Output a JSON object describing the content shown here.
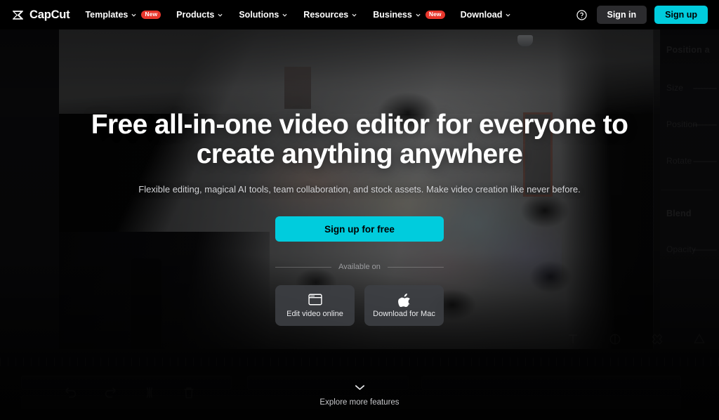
{
  "navbar": {
    "brand": {
      "logo_icon": "capcut-logo-icon",
      "name": "CapCut"
    },
    "links": [
      {
        "label": "Templates",
        "caret": "chevron-down-icon",
        "badge": "New"
      },
      {
        "label": "Products",
        "caret": "chevron-down-icon",
        "badge": ""
      },
      {
        "label": "Solutions",
        "caret": "chevron-down-icon",
        "badge": ""
      },
      {
        "label": "Resources",
        "caret": "chevron-down-icon",
        "badge": ""
      },
      {
        "label": "Business",
        "caret": "chevron-down-icon",
        "badge": "New"
      },
      {
        "label": "Download",
        "caret": "chevron-down-icon",
        "badge": ""
      }
    ],
    "help_icon": "help-circle-icon",
    "sign_in_label": "Sign in",
    "sign_up_label": "Sign up"
  },
  "hero": {
    "headline": "Free all-in-one video editor for everyone to create anything anywhere",
    "subheadline": "Flexible editing, magical AI tools, team collaboration, and stock assets. Make video creation like never before.",
    "cta_label": "Sign up for free",
    "available_on_label": "Available on",
    "platforms": [
      {
        "label": "Edit video online",
        "icon": "browser-window-icon"
      },
      {
        "label": "Download for Mac",
        "icon": "apple-logo-icon"
      }
    ]
  },
  "explore": {
    "icon": "chevron-down-icon",
    "label": "Explore more features"
  },
  "editor_background": {
    "side_panel": {
      "title": "Position a",
      "rows": [
        "Size",
        "Position",
        "Rotate"
      ],
      "section_title": "Blend",
      "section_rows": [
        "Opacity"
      ]
    },
    "preview_tools": [
      "text-icon",
      "mask-icon",
      "sticker-icon",
      "shape-icon"
    ],
    "mini_tools": [
      "chevron-down-icon",
      "fullscreen-icon"
    ],
    "timeline_tools": [
      "undo-icon",
      "redo-icon",
      "split-icon",
      "delete-icon"
    ]
  },
  "colors": {
    "accent_cyan": "#00ccdd",
    "badge_red": "#e8362c",
    "nav_bg": "#000000",
    "signin_bg": "#2b2b2e"
  }
}
